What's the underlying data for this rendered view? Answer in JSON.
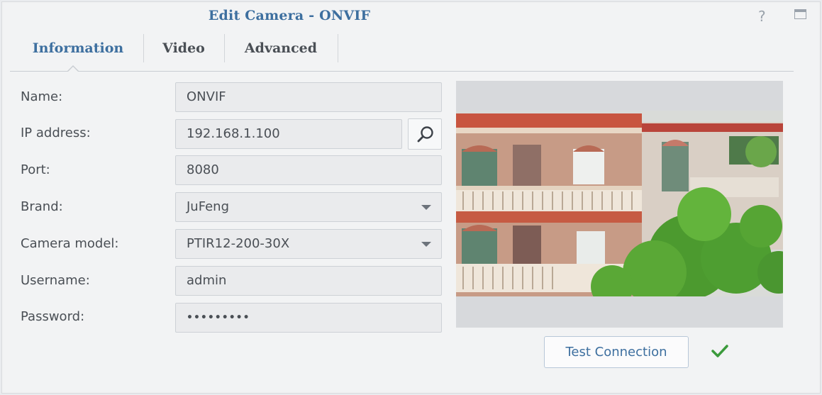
{
  "window": {
    "title": "Edit Camera - ONVIF",
    "help_glyph": "?"
  },
  "tabs": [
    {
      "label": "Information",
      "active": true
    },
    {
      "label": "Video",
      "active": false
    },
    {
      "label": "Advanced",
      "active": false
    }
  ],
  "form": {
    "name": {
      "label": "Name:",
      "value": "ONVIF"
    },
    "ip": {
      "label": "IP address:",
      "value": "192.168.1.100"
    },
    "port": {
      "label": "Port:",
      "value": "8080"
    },
    "brand": {
      "label": "Brand:",
      "value": "JuFeng"
    },
    "model": {
      "label": "Camera model:",
      "value": "PTIR12-200-30X"
    },
    "username": {
      "label": "Username:",
      "value": "admin"
    },
    "password": {
      "label": "Password:",
      "value": "•••••••••"
    }
  },
  "test_connection_label": "Test Connection",
  "colors": {
    "accent": "#3d6f9f",
    "success": "#3b9a3b"
  },
  "icons": {
    "help": "question-icon",
    "restore": "restore-window-icon",
    "search": "search-icon",
    "status": "checkmark-icon"
  }
}
